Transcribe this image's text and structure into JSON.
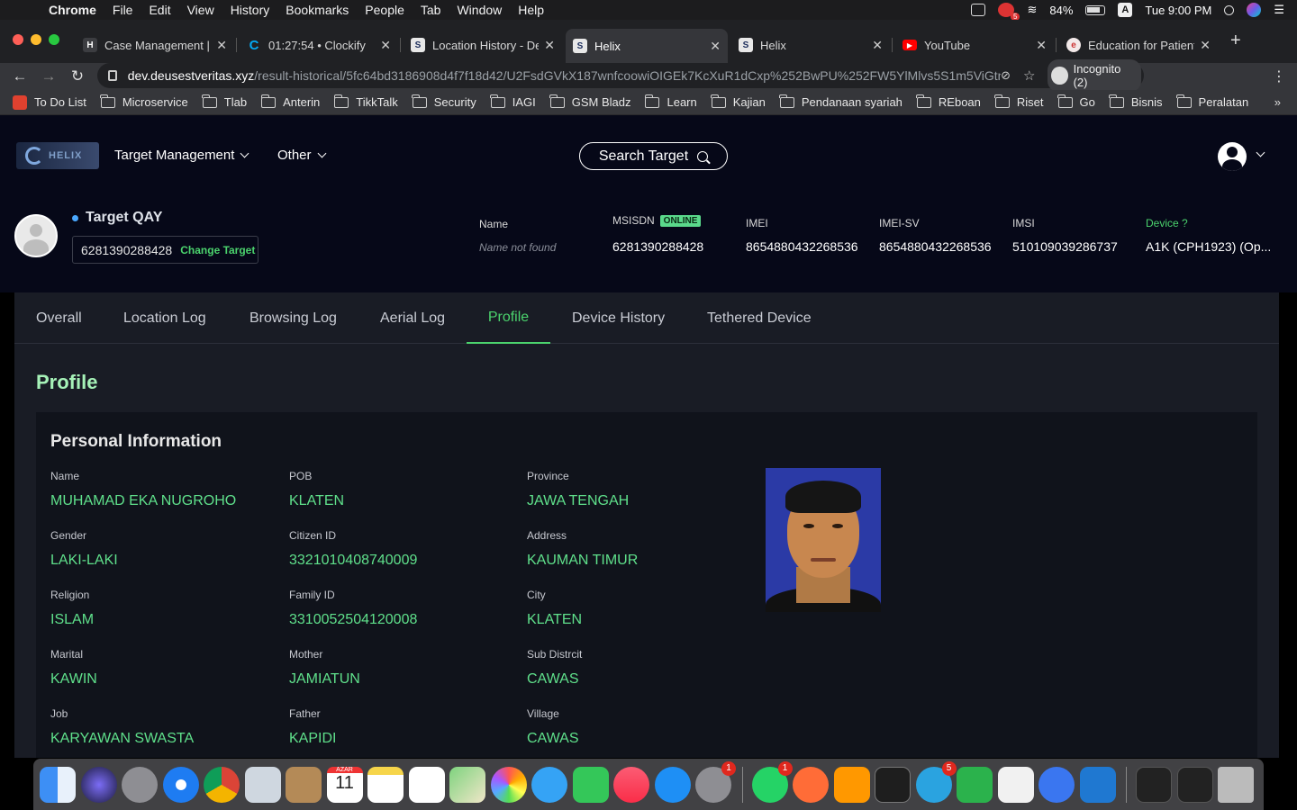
{
  "menubar": {
    "app": "Chrome",
    "items": [
      "File",
      "Edit",
      "View",
      "History",
      "Bookmarks",
      "People",
      "Tab",
      "Window",
      "Help"
    ],
    "battery": "84%",
    "input_source": "A",
    "clock": "Tue 9:00 PM",
    "notification_badge": "5"
  },
  "tabs": [
    {
      "fav": "H",
      "fav_color": "#3c3d41",
      "title": "Case Management | I"
    },
    {
      "fav": "C",
      "fav_color": "#03a9f4",
      "title": "01:27:54 • Clockify"
    },
    {
      "fav": "S",
      "fav_color": "#e8e8e8",
      "title": "Location History - De"
    },
    {
      "fav": "S",
      "fav_color": "#e8e8e8",
      "title": "Helix"
    },
    {
      "fav": "S",
      "fav_color": "#e8e8e8",
      "title": "Helix"
    },
    {
      "fav": "▶",
      "fav_color": "#ff0000",
      "title": "YouTube"
    },
    {
      "fav": "e",
      "fav_color": "#f3e9e9",
      "title": "Education for Patient"
    }
  ],
  "url": {
    "host": "dev.deusestveritas.xyz",
    "path": "/result-historical/5fc64bd3186908d4f7f18d42/U2FsdGVkX187wnfcoowiOIGEk7KcXuR1dCxp%252BwPU%252FW5YlMlvs5S1m5ViGtn2dRt..."
  },
  "incognito": "Incognito (2)",
  "bookmarks": [
    "To Do List",
    "Microservice",
    "Tlab",
    "Anterin",
    "TikkTalk",
    "Security",
    "IAGI",
    "GSM Bladz",
    "Learn",
    "Kajian",
    "Pendanaan syariah",
    "REboan",
    "Riset",
    "Go",
    "Bisnis",
    "Peralatan"
  ],
  "nav": {
    "logo": "HELIX",
    "target_management": "Target Management",
    "other": "Other",
    "search": "Search Target"
  },
  "target": {
    "name": "Target QAY",
    "msisdn_box": "6281390288428",
    "change": "Change Target",
    "name_label": "Name",
    "name_value": "Name not found",
    "msisdn_label": "MSISDN",
    "status": "ONLINE",
    "msisdn": "6281390288428",
    "imei_label": "IMEI",
    "imei": "8654880432268536",
    "imeisv_label": "IMEI-SV",
    "imeisv": "8654880432268536",
    "imsi_label": "IMSI",
    "imsi": "510109039286737",
    "device_label": "Device ?",
    "device": "A1K (CPH1923) (Op..."
  },
  "profile_tabs": [
    "Overall",
    "Location Log",
    "Browsing Log",
    "Aerial Log",
    "Profile",
    "Device History",
    "Tethered Device"
  ],
  "profile": {
    "title": "Profile",
    "section": "Personal Information",
    "col1": [
      {
        "label": "Name",
        "value": "MUHAMAD EKA NUGROHO"
      },
      {
        "label": "Gender",
        "value": "LAKI-LAKI"
      },
      {
        "label": "Religion",
        "value": "ISLAM"
      },
      {
        "label": "Marital",
        "value": "KAWIN"
      },
      {
        "label": "Job",
        "value": "KARYAWAN SWASTA"
      }
    ],
    "col2": [
      {
        "label": "POB",
        "value": "KLATEN"
      },
      {
        "label": "Citizen ID",
        "value": "3321010408740009"
      },
      {
        "label": "Family ID",
        "value": "3310052504120008"
      },
      {
        "label": "Mother",
        "value": "JAMIATUN"
      },
      {
        "label": "Father",
        "value": "KAPIDI"
      }
    ],
    "col3": [
      {
        "label": "Province",
        "value": "JAWA TENGAH"
      },
      {
        "label": "Address",
        "value": "KAUMAN TIMUR"
      },
      {
        "label": "City",
        "value": "KLATEN"
      },
      {
        "label": "Sub Distrcit",
        "value": "CAWAS"
      },
      {
        "label": "Village",
        "value": "CAWAS"
      }
    ]
  },
  "dock": {
    "calendar_month": "AZAR",
    "calendar_day": "11",
    "badges": {
      "system_prefs": "1",
      "whatsapp": "1",
      "telegram": "5"
    }
  }
}
